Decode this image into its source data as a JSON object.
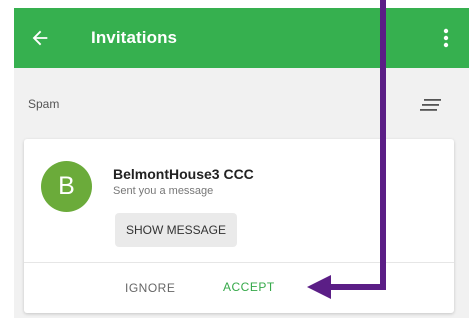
{
  "app_bar": {
    "title": "Invitations",
    "back_icon": "arrow-left-icon",
    "menu_icon": "more-vert-icon",
    "color": "#36b04f"
  },
  "filter": {
    "label": "Spam",
    "sort_icon": "sort-icon"
  },
  "invitation": {
    "avatar_letter": "B",
    "avatar_color": "#6bab3a",
    "sender": "BelmontHouse3 CCC",
    "subtitle": "Sent you a message",
    "show_message_label": "SHOW MESSAGE",
    "ignore_label": "IGNORE",
    "accept_label": "ACCEPT",
    "accept_color": "#36a94a"
  },
  "annotation": {
    "color": "#5b1e86",
    "icon": "arrow-annotation-icon"
  }
}
